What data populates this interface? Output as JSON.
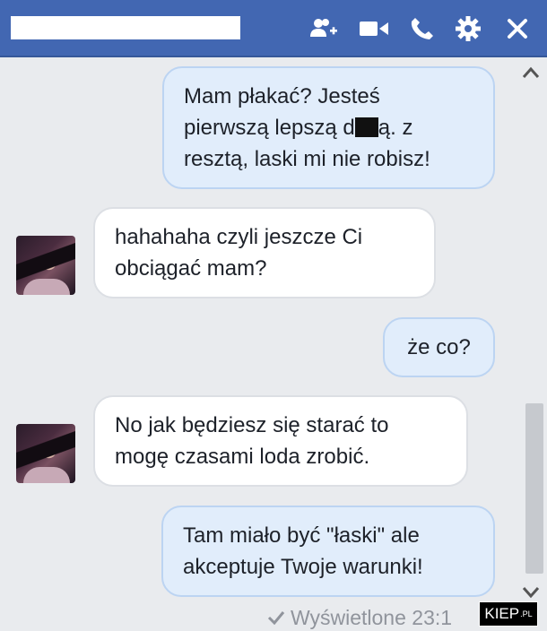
{
  "header": {
    "title": "",
    "icons": [
      "add-people-icon",
      "video-call-icon",
      "phone-call-icon",
      "settings-gear-icon",
      "close-icon"
    ]
  },
  "messages": [
    {
      "side": "out",
      "parts": [
        "Mam płakać? Jesteś",
        "pierwszą lepszą d",
        "ą. z",
        "resztą, laski mi nie robisz!"
      ]
    },
    {
      "side": "in",
      "lines": [
        "hahahaha czyli jeszcze Ci",
        "obciągać mam?"
      ]
    },
    {
      "side": "out",
      "lines": [
        "że co?"
      ]
    },
    {
      "side": "in",
      "lines": [
        "No jak będziesz się starać to",
        "mogę czasami loda zrobić."
      ]
    },
    {
      "side": "out",
      "lines": [
        "Tam miało być \"łaski\" ale",
        "akceptuje Twoje warunki!"
      ]
    }
  ],
  "status": {
    "seen_text": "Wyświetlone 23:1"
  },
  "watermark": {
    "text": "KIEP",
    "suffix": ".PL"
  },
  "colors": {
    "header": "#4267b2",
    "outgoing_bubble": "#e1edfb",
    "incoming_bubble": "#ffffff",
    "background": "#e9ebee"
  }
}
